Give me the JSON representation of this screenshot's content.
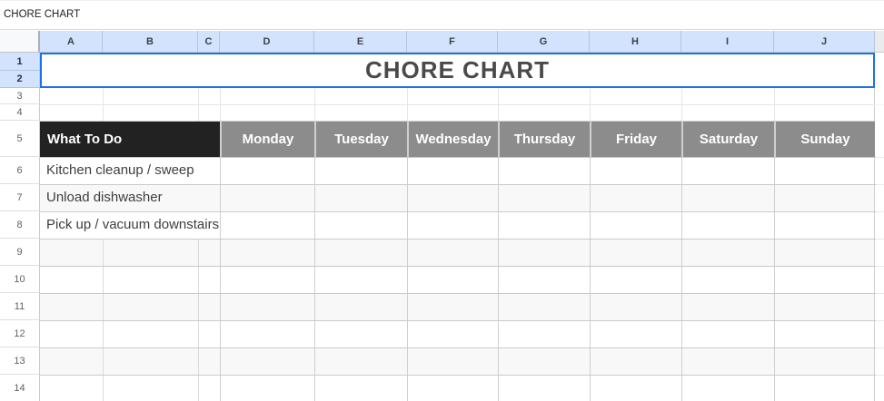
{
  "page": {
    "top_label": "CHORE CHART"
  },
  "grid": {
    "column_letters": [
      "A",
      "B",
      "C",
      "D",
      "E",
      "F",
      "G",
      "H",
      "I",
      "J"
    ],
    "row_numbers": [
      "1",
      "2",
      "3",
      "4",
      "5",
      "6",
      "7",
      "8",
      "9",
      "10",
      "11",
      "12",
      "13",
      "14"
    ],
    "selected_rows": [
      "1",
      "2"
    ],
    "selected_range": "A1:J2"
  },
  "title_cell": {
    "text": "CHORE CHART"
  },
  "table": {
    "header": {
      "what_to_do": "What To Do",
      "days": [
        "Monday",
        "Tuesday",
        "Wednesday",
        "Thursday",
        "Friday",
        "Saturday",
        "Sunday"
      ]
    },
    "chores": [
      "Kitchen cleanup / sweep",
      "Unload dishwasher",
      "Pick up / vacuum downstairs"
    ]
  },
  "colors": {
    "selection_border": "#1a73e8",
    "selected_header_bg": "#d3e3fd",
    "what_to_do_bg": "#222222",
    "day_header_bg": "#8c8c8c",
    "day_header_text": "#ffffff",
    "row_banding": "#f8f8f8",
    "title_text": "#4a4a4a"
  }
}
